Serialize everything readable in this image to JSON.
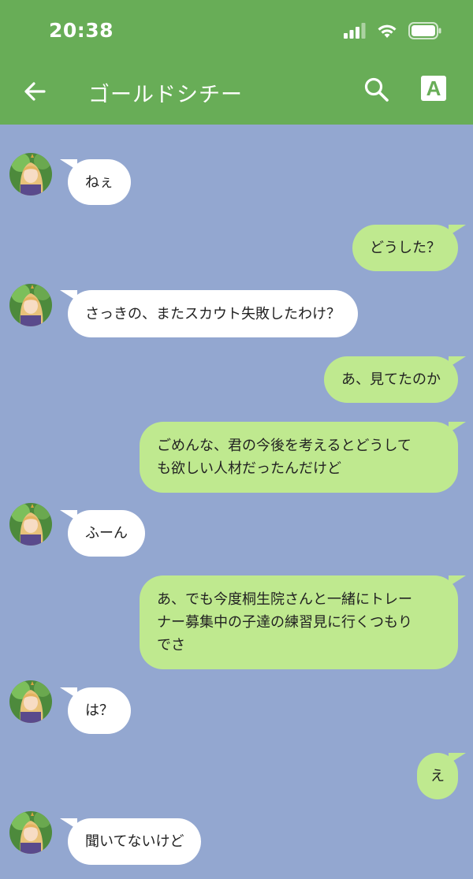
{
  "status_bar": {
    "time": "20:38"
  },
  "header": {
    "title": "ゴールドシチー",
    "translate_label": "A"
  },
  "messages": [
    {
      "side": "in",
      "text": "ねぇ"
    },
    {
      "side": "out",
      "text": "どうした？"
    },
    {
      "side": "in",
      "text": "さっきの、またスカウト失敗したわけ？"
    },
    {
      "side": "out",
      "text": "あ、見てたのか"
    },
    {
      "side": "out",
      "lines": [
        "ごめんな、君の今後を考えるとどうして",
        "も欲しい人材だったんだけど"
      ]
    },
    {
      "side": "in",
      "text": "ふーん"
    },
    {
      "side": "out",
      "lines": [
        "あ、でも今度桐生院さんと一緒にトレー",
        "ナー募集中の子達の練習見に行くつもり",
        "でさ"
      ]
    },
    {
      "side": "in",
      "text": "は？"
    },
    {
      "side": "out",
      "text": "え"
    },
    {
      "side": "in",
      "text": "聞いてないけど"
    }
  ],
  "colors": {
    "header_green": "#68ad57",
    "chat_background": "#93a7d0",
    "outgoing_bubble": "#bfe98f",
    "incoming_bubble": "#ffffff"
  },
  "icons": [
    "signal-icon",
    "wifi-icon",
    "battery-icon",
    "back-arrow-icon",
    "search-icon",
    "translate-icon"
  ]
}
